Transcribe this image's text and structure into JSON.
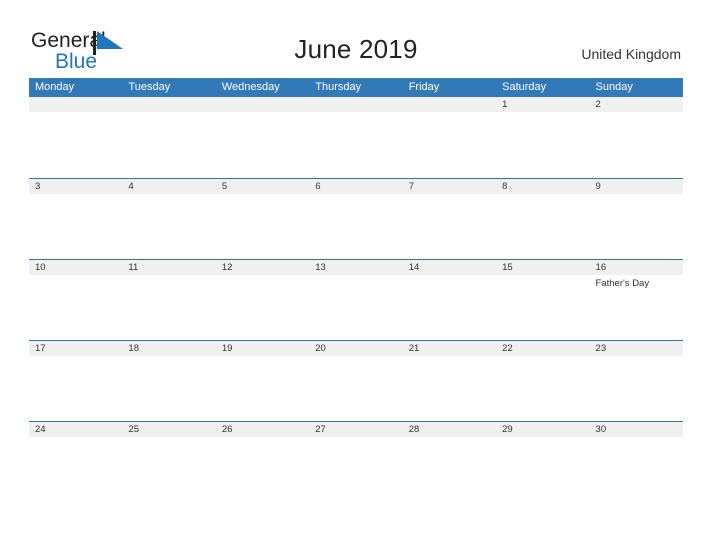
{
  "brand": {
    "name_part1": "General",
    "name_part2": "Blue",
    "mark": "triangle-logo-icon",
    "color_text": "#231f20",
    "color_accent": "#2175bd"
  },
  "header": {
    "title": "June 2019",
    "country": "United Kingdom"
  },
  "theme": {
    "header_blue": "#3279b7",
    "row_divider_blue": "#2e73ad",
    "day_band_gray": "#f0f0f0",
    "text": "#333333"
  },
  "calendar": {
    "weekday_headers": [
      "Monday",
      "Tuesday",
      "Wednesday",
      "Thursday",
      "Friday",
      "Saturday",
      "Sunday"
    ],
    "weeks": [
      {
        "days": [
          {
            "date": "",
            "events": []
          },
          {
            "date": "",
            "events": []
          },
          {
            "date": "",
            "events": []
          },
          {
            "date": "",
            "events": []
          },
          {
            "date": "",
            "events": []
          },
          {
            "date": "1",
            "events": []
          },
          {
            "date": "2",
            "events": []
          }
        ]
      },
      {
        "days": [
          {
            "date": "3",
            "events": []
          },
          {
            "date": "4",
            "events": []
          },
          {
            "date": "5",
            "events": []
          },
          {
            "date": "6",
            "events": []
          },
          {
            "date": "7",
            "events": []
          },
          {
            "date": "8",
            "events": []
          },
          {
            "date": "9",
            "events": []
          }
        ]
      },
      {
        "days": [
          {
            "date": "10",
            "events": []
          },
          {
            "date": "11",
            "events": []
          },
          {
            "date": "12",
            "events": []
          },
          {
            "date": "13",
            "events": []
          },
          {
            "date": "14",
            "events": []
          },
          {
            "date": "15",
            "events": []
          },
          {
            "date": "16",
            "events": [
              "Father's Day"
            ]
          }
        ]
      },
      {
        "days": [
          {
            "date": "17",
            "events": []
          },
          {
            "date": "18",
            "events": []
          },
          {
            "date": "19",
            "events": []
          },
          {
            "date": "20",
            "events": []
          },
          {
            "date": "21",
            "events": []
          },
          {
            "date": "22",
            "events": []
          },
          {
            "date": "23",
            "events": []
          }
        ]
      },
      {
        "days": [
          {
            "date": "24",
            "events": []
          },
          {
            "date": "25",
            "events": []
          },
          {
            "date": "26",
            "events": []
          },
          {
            "date": "27",
            "events": []
          },
          {
            "date": "28",
            "events": []
          },
          {
            "date": "29",
            "events": []
          },
          {
            "date": "30",
            "events": []
          }
        ]
      }
    ]
  }
}
